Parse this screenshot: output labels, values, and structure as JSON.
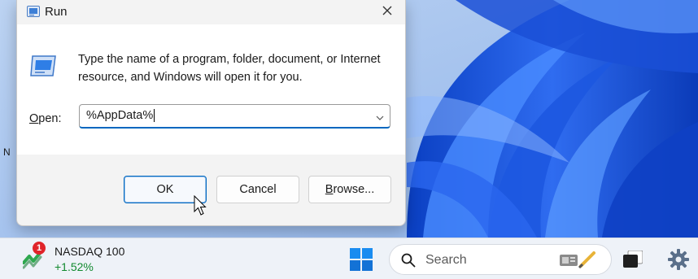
{
  "dialog": {
    "title": "Run",
    "message": "Type the name of a program, folder, document, or Internet resource, and Windows will open it for you.",
    "open_label_accel": "O",
    "open_label_rest": "pen:",
    "open_value": "%AppData%",
    "buttons": {
      "ok": "OK",
      "cancel": "Cancel",
      "browse_accel": "B",
      "browse_rest": "rowse..."
    }
  },
  "desktop": {
    "clipped_label": "N"
  },
  "taskbar": {
    "widget": {
      "badge_count": "1",
      "name": "NASDAQ 100",
      "change": "+1.52%"
    },
    "search_placeholder": "Search"
  },
  "icons": {
    "run": "run-icon",
    "close": "close-icon",
    "dropdown": "chevron-down-icon",
    "cursor": "mouse-pointer-icon",
    "stock": "stock-chart-icon",
    "start": "windows-start-icon",
    "search": "search-icon",
    "search_highlight": "search-highlight-icon",
    "task_view": "task-view-icon",
    "settings": "gear-icon"
  },
  "colors": {
    "accent": "#0067c0",
    "wallpaper_blue": "#2b5fd9",
    "positive": "#128a2f",
    "badge": "#e0242a"
  }
}
